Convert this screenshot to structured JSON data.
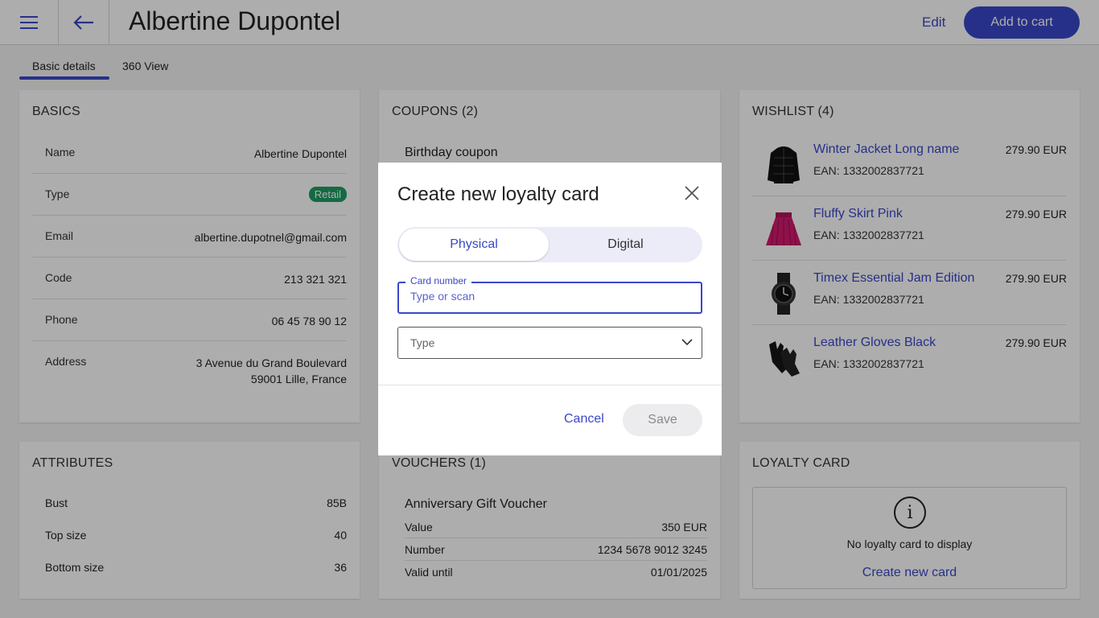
{
  "header": {
    "title": "Albertine Dupontel",
    "edit_label": "Edit",
    "add_to_cart_label": "Add to cart",
    "menu_icon": "menu-icon",
    "back_icon": "arrow-left-icon"
  },
  "tabs": [
    {
      "label": "Basic details",
      "active": true
    },
    {
      "label": "360 View",
      "active": false
    }
  ],
  "basics": {
    "title": "BASICS",
    "rows": [
      {
        "key": "Name",
        "value": "Albertine Dupontel"
      },
      {
        "key": "Type",
        "value": "Retail"
      },
      {
        "key": "Email",
        "value": "albertine.dupotnel@gmail.com"
      },
      {
        "key": "Code",
        "value": "213 321 321"
      },
      {
        "key": "Phone",
        "value": "06 45 78 90 12"
      },
      {
        "key": "Address",
        "value_line1": "3 Avenue du Grand Boulevard",
        "value_line2": "59001 Lille, France"
      }
    ]
  },
  "attributes": {
    "title": "ATTRIBUTES",
    "rows": [
      {
        "key": "Bust",
        "value": "85B"
      },
      {
        "key": "Top size",
        "value": "40"
      },
      {
        "key": "Bottom size",
        "value": "36"
      }
    ]
  },
  "coupons": {
    "title": "COUPONS (2)",
    "first_item": "Birthday coupon"
  },
  "vouchers": {
    "title": "VOUCHERS (1)",
    "item_title": "Anniversary Gift Voucher",
    "rows": [
      {
        "key": "Value",
        "value": "350 EUR"
      },
      {
        "key": "Number",
        "value": "1234 5678 9012 3245"
      },
      {
        "key": "Valid until",
        "value": "01/01/2025"
      }
    ]
  },
  "wishlist": {
    "title": "WISHLIST (4)",
    "items": [
      {
        "name": "Winter Jacket Long name",
        "ean": "EAN: 1332002837721",
        "price": "279.90 EUR",
        "icon": "jacket-image"
      },
      {
        "name": "Fluffy Skirt Pink",
        "ean": "EAN: 1332002837721",
        "price": "279.90 EUR",
        "icon": "skirt-image"
      },
      {
        "name": "Timex Essential Jam Edition",
        "ean": "EAN: 1332002837721",
        "price": "279.90 EUR",
        "icon": "watch-image"
      },
      {
        "name": "Leather Gloves Black",
        "ean": "EAN: 1332002837721",
        "price": "279.90 EUR",
        "icon": "gloves-image"
      }
    ]
  },
  "loyalty": {
    "title": "LOYALTY CARD",
    "message": "No loyalty card to display",
    "create_label": "Create new card",
    "icon": "info-icon"
  },
  "modal": {
    "title": "Create new loyalty card",
    "segment_physical": "Physical",
    "segment_digital": "Digital",
    "active_segment": "Physical",
    "card_number_label": "Card number",
    "card_number_placeholder": "Type or scan",
    "card_number_value": "",
    "type_placeholder": "Type",
    "cancel_label": "Cancel",
    "save_label": "Save"
  },
  "colors": {
    "accent": "#3a47c9",
    "badge_green": "#1f9d63",
    "overlay": "rgba(0,0,0,0.32)"
  }
}
